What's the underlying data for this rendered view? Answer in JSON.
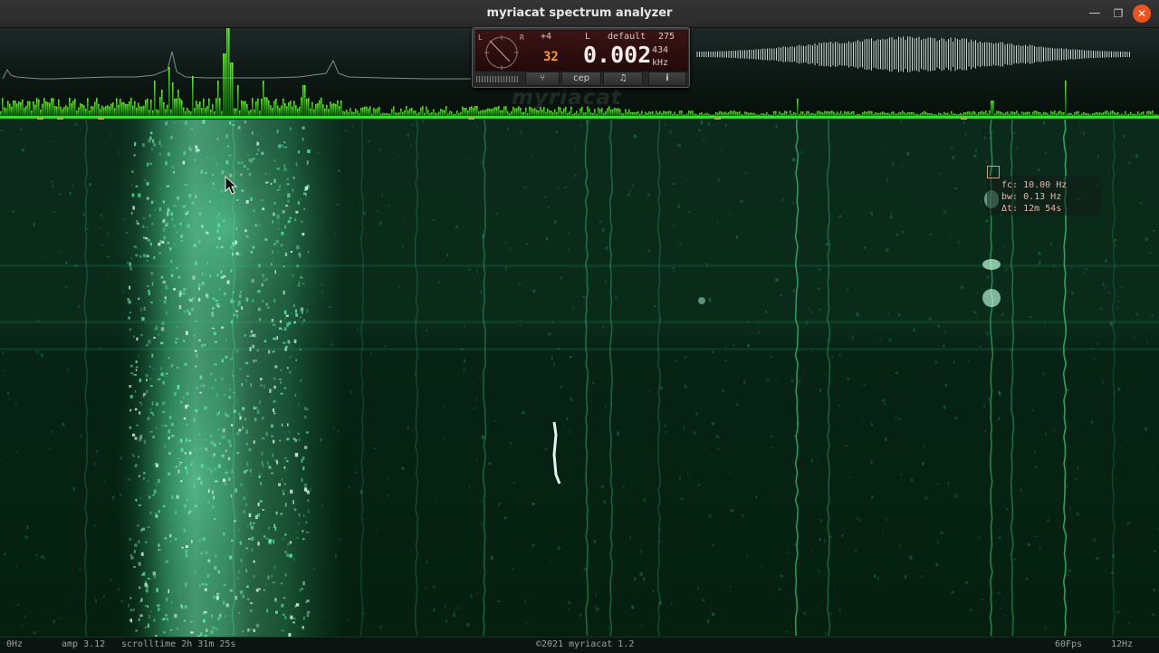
{
  "window": {
    "title": "myriacat spectrum analyzer",
    "minimize_icon": "minimize-icon",
    "maximize_icon": "restore-icon",
    "close_icon": "close-icon",
    "minimize_glyph": "—",
    "maximize_glyph": "❐",
    "close_glyph": "✕"
  },
  "panel": {
    "gain": "+4",
    "channel": "L",
    "preset": "default",
    "preset_number": "275",
    "bits": "32",
    "frequency": "0.002",
    "note": "434",
    "unit": "kHz",
    "dial_labels": [
      "L",
      "R"
    ],
    "buttons": [
      {
        "icon": "tuning-fork-icon",
        "label": "⑂"
      },
      {
        "icon": "cepstrum-icon",
        "label": "cep"
      },
      {
        "icon": "music-note-icon",
        "label": "♫"
      },
      {
        "icon": "info-icon",
        "label": "i"
      }
    ]
  },
  "watermark": "myriacat",
  "readout": {
    "fc": "fc: 10.00 Hz",
    "bw": "bw: 0.13 Hz",
    "dt": "Δt: 12m 54s"
  },
  "status": {
    "left_freq": "0Hz",
    "amp": "amp 3.12",
    "scrolltime": "scrolltime 2h 31m 25s",
    "copyright": "©2021 myriacat 1.2",
    "fps": "60Fps",
    "right_freq": "12Hz"
  },
  "colors": {
    "accent": "#e95420",
    "spectrum_green": "#3aff3a",
    "trace_green": "#6affb0",
    "marker_gold": "#c9a34a",
    "readout_text": "#e2b7a6"
  }
}
